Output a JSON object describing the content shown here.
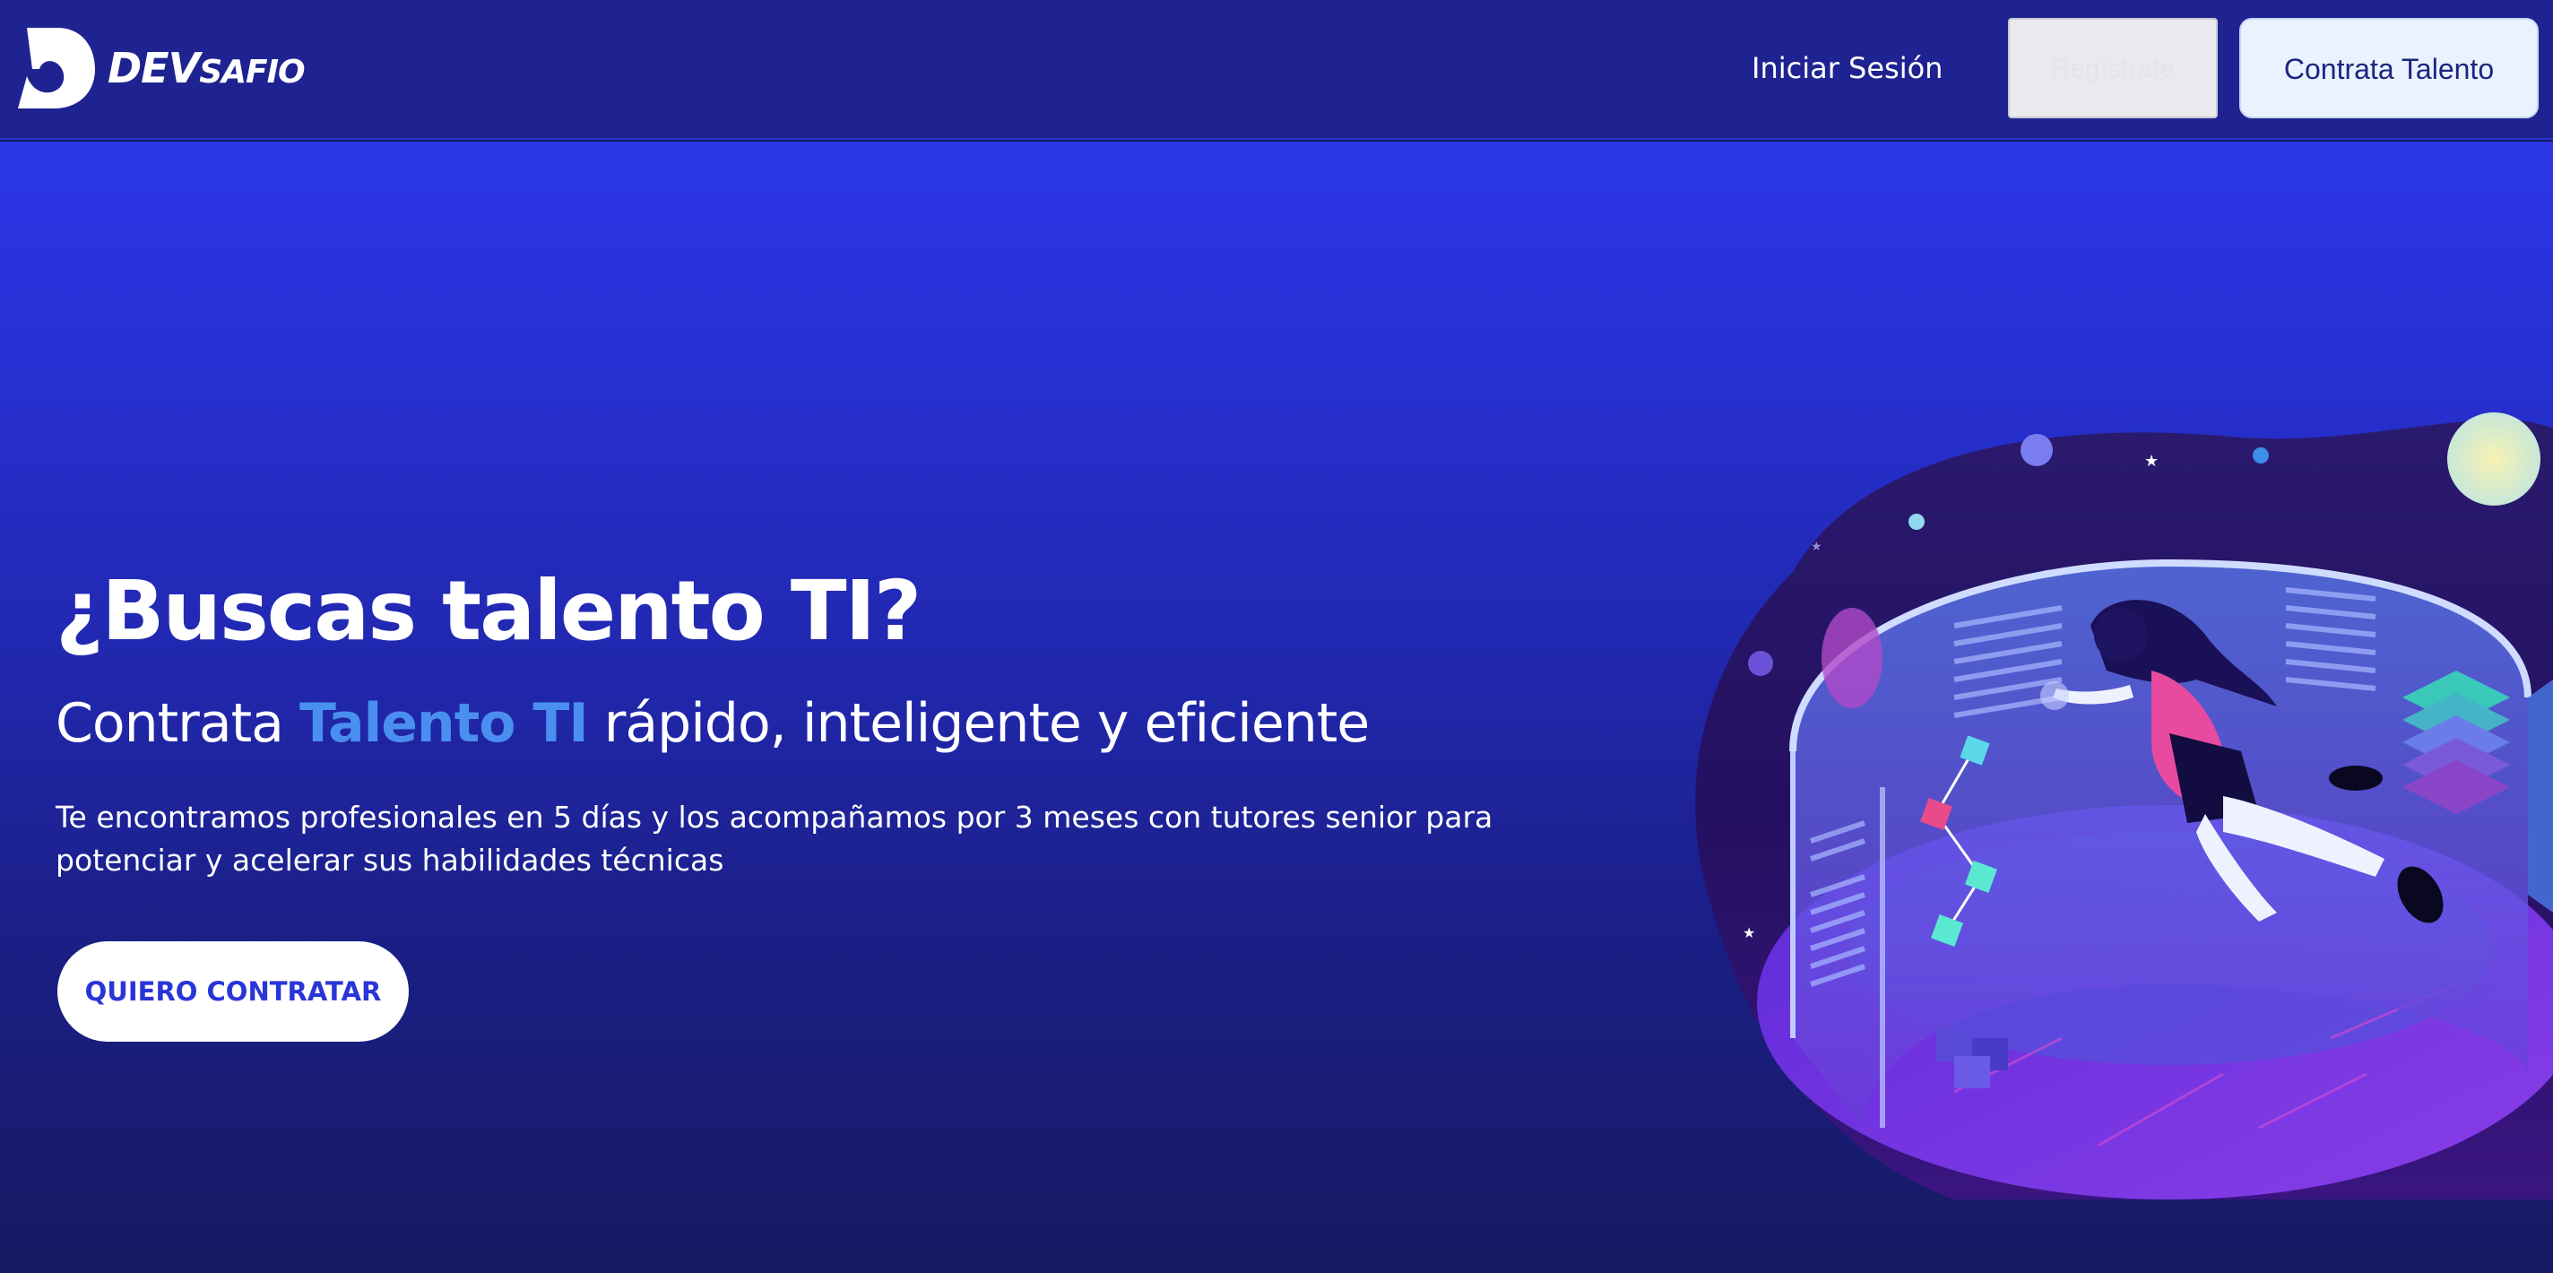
{
  "header": {
    "brand": {
      "prefix": "DEV",
      "suffix": "SAFIO"
    },
    "login_label": "Iniciar Sesión",
    "ghost_button_label": "Regístrate",
    "hire_button_label": "Contrata Talento"
  },
  "hero": {
    "title": "¿Buscas talento TI?",
    "subtitle_before": "Contrata ",
    "subtitle_accent": "Talento TI",
    "subtitle_after": " rápido, inteligente y eficiente",
    "description": "Te encontramos profesionales en 5 días y los acompañamos por 3 meses con tutores senior para potenciar y acelerar sus habilidades técnicas",
    "cta_label": "QUIERO CONTRATAR"
  },
  "colors": {
    "header_bg": "#1f2391",
    "hero_top": "#2b36e8",
    "hero_bottom": "#161a62",
    "accent": "#4a8ff0",
    "cta_text": "#2a35d8"
  }
}
